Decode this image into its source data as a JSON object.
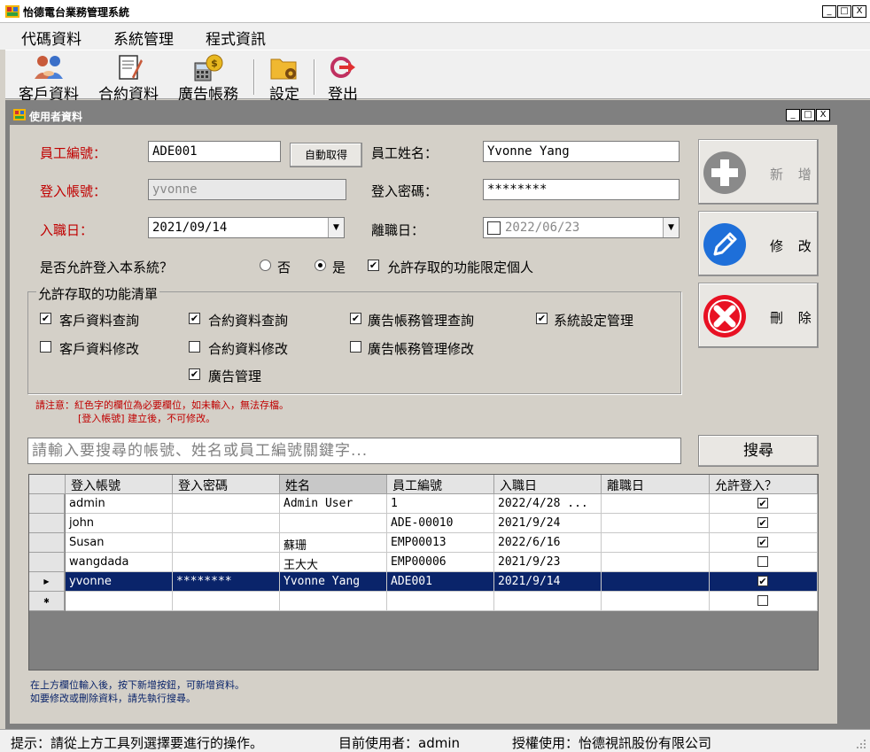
{
  "app": {
    "title": "怡德電台業務管理系統",
    "win_min": "_",
    "win_max": "□",
    "win_close": "X"
  },
  "menu": {
    "items": [
      "代碼資料",
      "系統管理",
      "程式資訊"
    ]
  },
  "toolbar": {
    "items": [
      {
        "label": "客戶資料",
        "icon": "customers-icon"
      },
      {
        "label": "合約資料",
        "icon": "contract-icon"
      },
      {
        "label": "廣告帳務",
        "icon": "ad-accounting-icon"
      },
      {
        "label": "設定",
        "icon": "settings-folder-icon"
      },
      {
        "label": "登出",
        "icon": "logout-icon"
      }
    ]
  },
  "child": {
    "title": "使用者資料",
    "win_min": "_",
    "win_max": "□",
    "win_close": "X"
  },
  "form": {
    "employee_id_label": "員工編號：",
    "employee_id_value": "ADE001",
    "auto_get_button": "自動取得",
    "employee_name_label": "員工姓名：",
    "employee_name_value": "Yvonne Yang",
    "login_account_label": "登入帳號：",
    "login_account_value": "yvonne",
    "login_password_label": "登入密碼：",
    "login_password_value": "********",
    "hire_date_label": "入職日：",
    "hire_date_value": "2021/09/14",
    "leave_date_label": "離職日：",
    "leave_date_value": "2022/06/23",
    "leave_date_checked": false,
    "allow_login_label": "是否允許登入本系統？",
    "allow_login_options": [
      {
        "label": "否",
        "selected": false
      },
      {
        "label": "是",
        "selected": true
      }
    ],
    "restrict_label": "允許存取的功能限定個人",
    "restrict_checked": true
  },
  "permissions": {
    "group_label": "允許存取的功能清單",
    "items": [
      {
        "label": "客戶資料查詢",
        "checked": true
      },
      {
        "label": "合約資料查詢",
        "checked": true
      },
      {
        "label": "廣告帳務管理查詢",
        "checked": true
      },
      {
        "label": "系統設定管理",
        "checked": true
      },
      {
        "label": "客戶資料修改",
        "checked": false
      },
      {
        "label": "合約資料修改",
        "checked": false
      },
      {
        "label": "廣告帳務管理修改",
        "checked": false
      },
      {
        "label": "廣告管理",
        "checked": true
      }
    ]
  },
  "notes": {
    "line1": "請注意：紅色字的欄位為必要欄位，如未輸入，無法存檔。",
    "line2": "[登入帳號] 建立後，不可修改。"
  },
  "actions": {
    "add": "新 增",
    "edit": "修 改",
    "delete": "刪 除",
    "add_color": "#8a8a8a",
    "edit_color": "#1e6fd9",
    "delete_color": "#e81123"
  },
  "search": {
    "placeholder": "請輸入要搜尋的帳號、姓名或員工編號關鍵字...",
    "button": "搜尋"
  },
  "grid": {
    "columns": [
      "登入帳號",
      "登入密碼",
      "姓名",
      "員工編號",
      "入職日",
      "離職日",
      "允許登入？"
    ],
    "rows": [
      {
        "account": "admin",
        "password": "",
        "name": "Admin User",
        "emp_id": "1",
        "hire": "2022/4/28 ...",
        "leave": "",
        "allow": true,
        "selected": false
      },
      {
        "account": "john",
        "password": "",
        "name": "",
        "emp_id": "ADE-00010",
        "hire": "2021/9/24",
        "leave": "",
        "allow": true,
        "selected": false
      },
      {
        "account": "Susan",
        "password": "",
        "name": "蘇珊",
        "emp_id": "EMP00013",
        "hire": "2022/6/16",
        "leave": "",
        "allow": true,
        "selected": false
      },
      {
        "account": "wangdada",
        "password": "",
        "name": "王大大",
        "emp_id": "EMP00006",
        "hire": "2021/9/23",
        "leave": "",
        "allow": false,
        "selected": false
      },
      {
        "account": "yvonne",
        "password": "********",
        "name": "Yvonne Yang",
        "emp_id": "ADE001",
        "hire": "2021/9/14",
        "leave": "",
        "allow": true,
        "selected": true
      },
      {
        "account": "",
        "password": "",
        "name": "",
        "emp_id": "",
        "hire": "",
        "leave": "",
        "allow": false,
        "selected": false,
        "new_row": true
      }
    ]
  },
  "footer_notes": {
    "line1": "在上方欄位輸入後，按下新增按鈕，可新增資料。",
    "line2": "如要修改或刪除資料，請先執行搜尋。"
  },
  "status": {
    "hint": "提示：請從上方工具列選擇要進行的操作。",
    "current_user": "目前使用者：admin",
    "license": "授權使用：怡德視訊股份有限公司"
  }
}
